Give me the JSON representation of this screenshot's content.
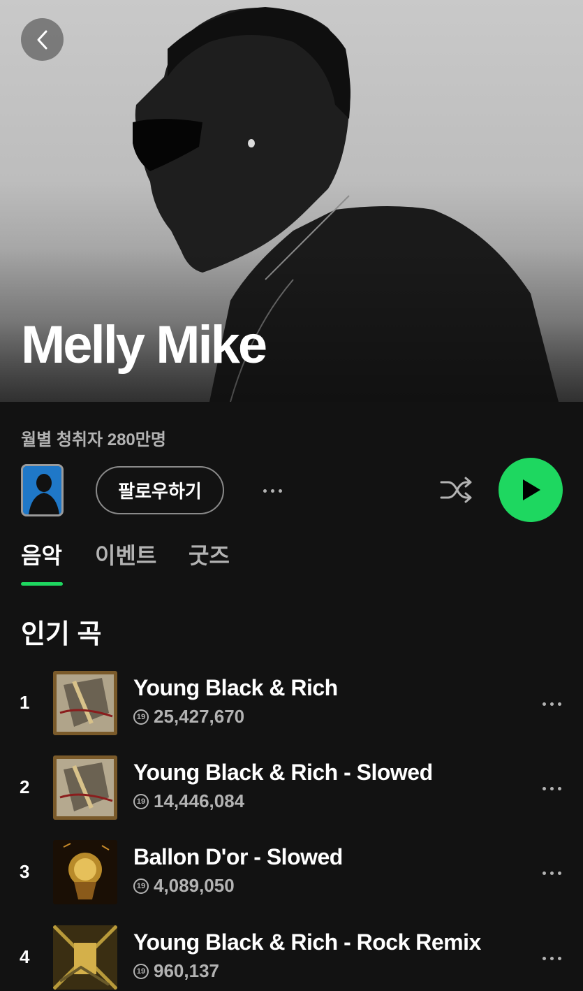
{
  "artist": {
    "name": "Melly Mike",
    "monthly_listeners": "월별 청취자 280만명"
  },
  "actions": {
    "follow_label": "팔로우하기"
  },
  "tabs": [
    {
      "label": "음악",
      "active": true
    },
    {
      "label": "이벤트",
      "active": false
    },
    {
      "label": "굿즈",
      "active": false
    }
  ],
  "section_title": "인기 곡",
  "tracks": [
    {
      "rank": "1",
      "title": "Young Black & Rich",
      "explicit_badge": "19",
      "plays": "25,427,670"
    },
    {
      "rank": "2",
      "title": "Young Black & Rich - Slowed",
      "explicit_badge": "19",
      "plays": "14,446,084"
    },
    {
      "rank": "3",
      "title": "Ballon D'or - Slowed",
      "explicit_badge": "19",
      "plays": "4,089,050"
    },
    {
      "rank": "4",
      "title": "Young Black & Rich - Rock Remix",
      "explicit_badge": "19",
      "plays": "960,137"
    }
  ],
  "colors": {
    "background": "#121212",
    "accent_green": "#1ed760",
    "secondary_text": "#b3b3b3"
  },
  "icons": {
    "back": "chevron-left-icon",
    "more": "more-horizontal-icon",
    "shuffle": "shuffle-icon",
    "play": "play-icon",
    "explicit": "explicit-19-icon"
  }
}
